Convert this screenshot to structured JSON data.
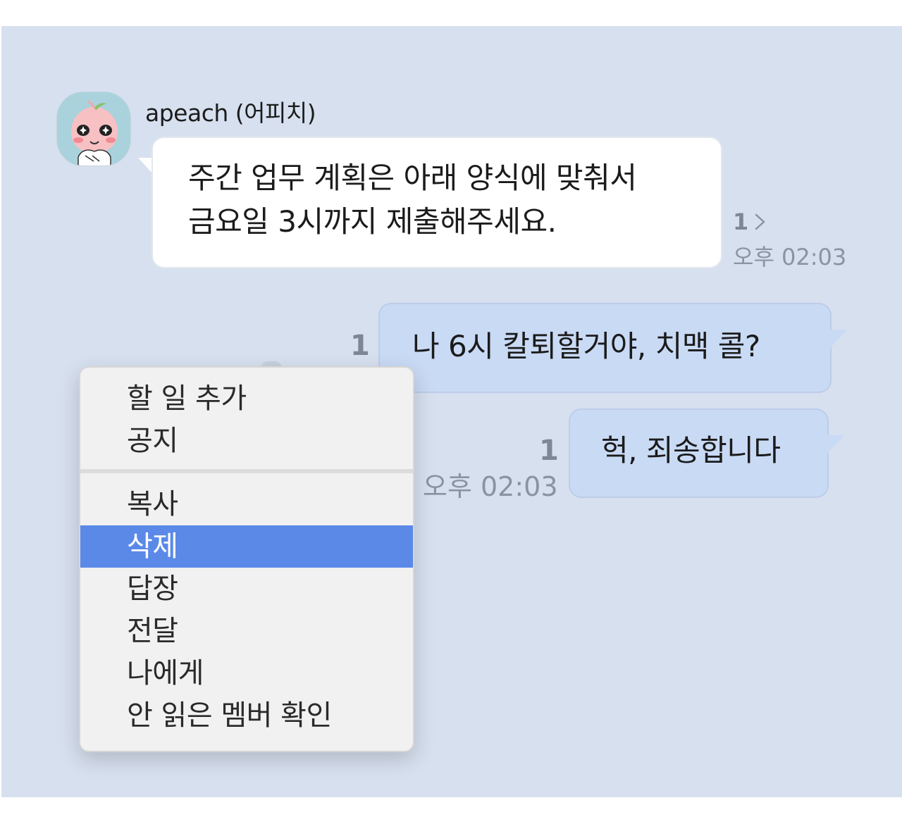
{
  "incoming": {
    "sender": "apeach (어피치)",
    "lines": [
      "주간 업무 계획은 아래 양식에 맞춰서",
      "금요일 3시까지 제출해주세요."
    ],
    "read_count": "1",
    "time": "오후 02:03"
  },
  "outgoing": [
    {
      "text": "나 6시 칼퇴할거야, 치맥 콜?",
      "read_count": "1"
    },
    {
      "text": "헉, 죄송합니다",
      "read_count": "1",
      "time": "오후 02:03"
    }
  ],
  "context_menu": {
    "items": [
      "할 일 추가",
      "공지",
      "복사",
      "삭제",
      "답장",
      "전달",
      "나에게",
      "안 읽은 멤버 확인"
    ],
    "selected": "삭제"
  },
  "colors": {
    "chat_background": "#d7e0ef",
    "outgoing_bubble": "#c9daf5",
    "incoming_bubble": "#ffffff",
    "menu_highlight": "#5a89e8"
  }
}
